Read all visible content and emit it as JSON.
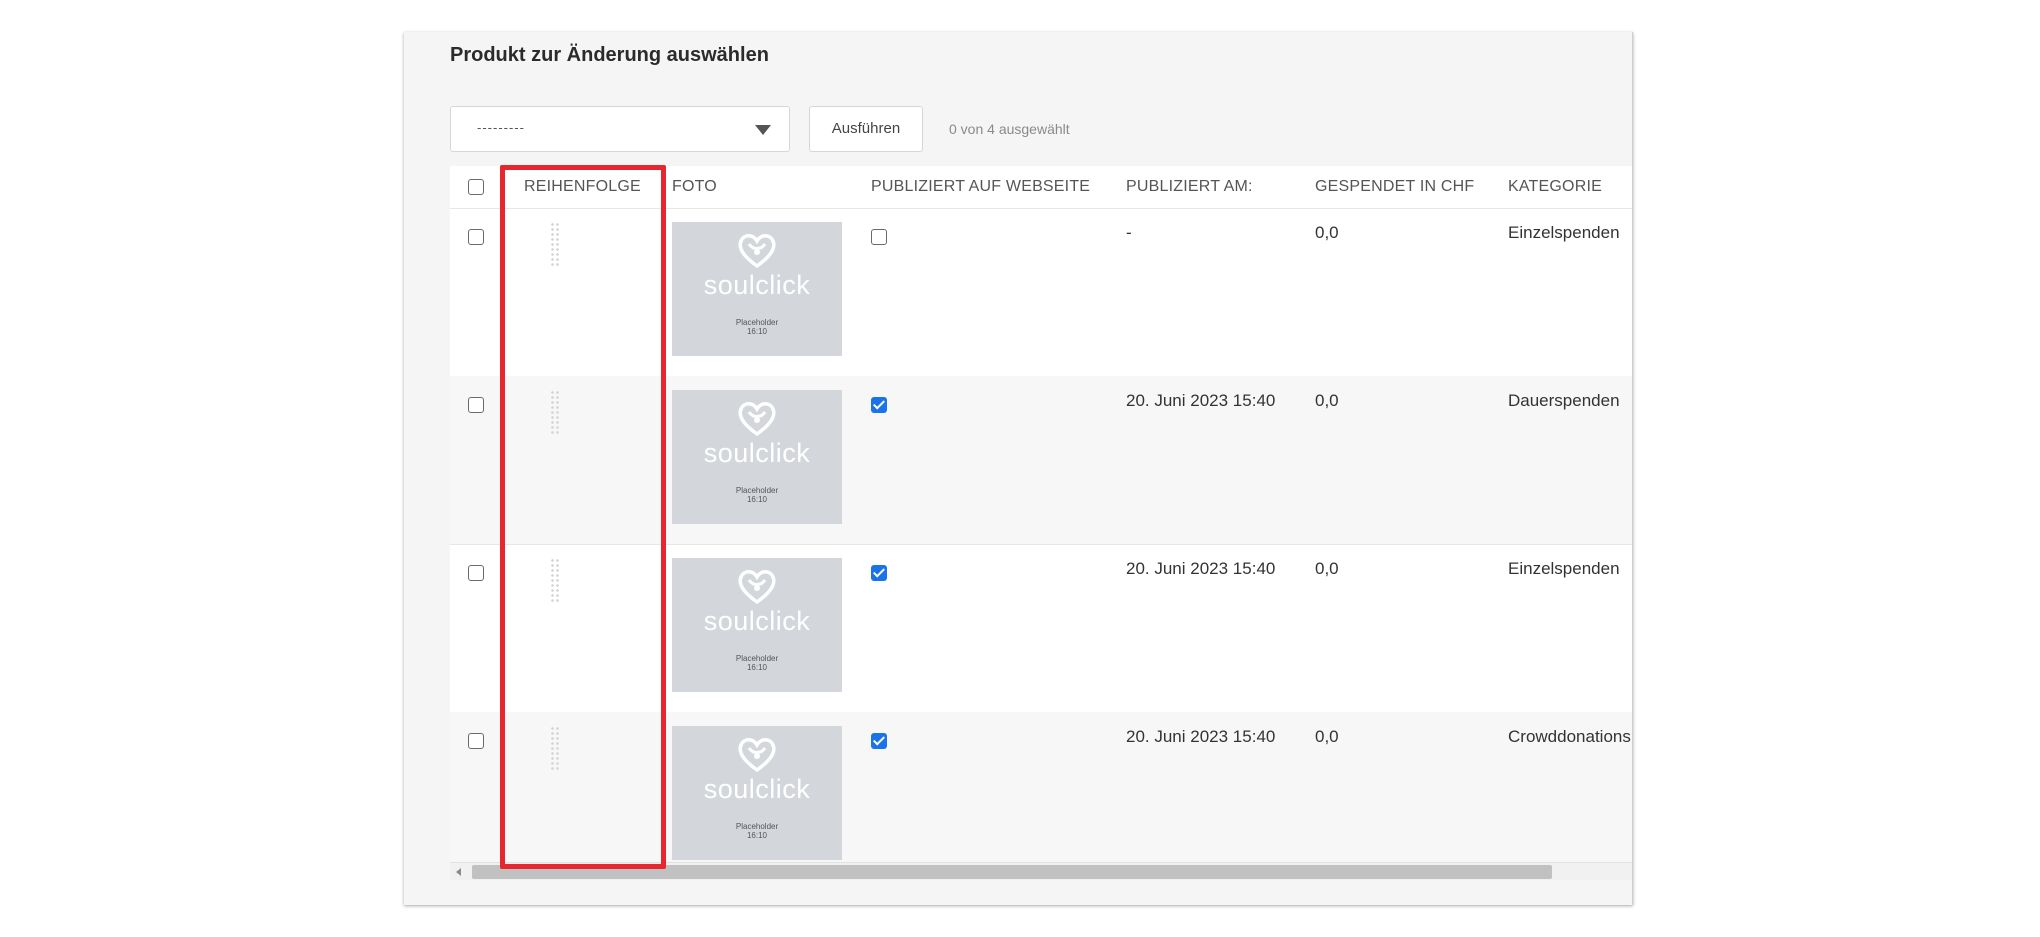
{
  "page": {
    "title": "Produkt zur Änderung auswählen"
  },
  "actions": {
    "select_value": "---------",
    "run_label": "Ausführen",
    "selection_counter": "0 von 4 ausgewählt"
  },
  "table": {
    "columns": [
      "REIHENFOLGE",
      "FOTO",
      "PUBLIZIERT AUF WEBSEITE",
      "PUBLIZIERT AM:",
      "GESPENDET IN CHF",
      "KATEGORIE"
    ],
    "thumbnail": {
      "brand": "soulclick",
      "placeholder_line1": "Placeholder",
      "placeholder_line2": "16:10"
    },
    "rows": [
      {
        "selected": false,
        "published": false,
        "published_at": "-",
        "donated": "0,0",
        "category": "Einzelspenden"
      },
      {
        "selected": false,
        "published": true,
        "published_at": "20. Juni 2023 15:40",
        "donated": "0,0",
        "category": "Dauerspenden"
      },
      {
        "selected": false,
        "published": true,
        "published_at": "20. Juni 2023 15:40",
        "donated": "0,0",
        "category": "Einzelspenden"
      },
      {
        "selected": false,
        "published": true,
        "published_at": "20. Juni 2023 15:40",
        "donated": "0,0",
        "category": "Crowddonations"
      }
    ]
  },
  "annotation": {
    "highlight_color": "#e8262d",
    "target_column": "REIHENFOLGE"
  }
}
